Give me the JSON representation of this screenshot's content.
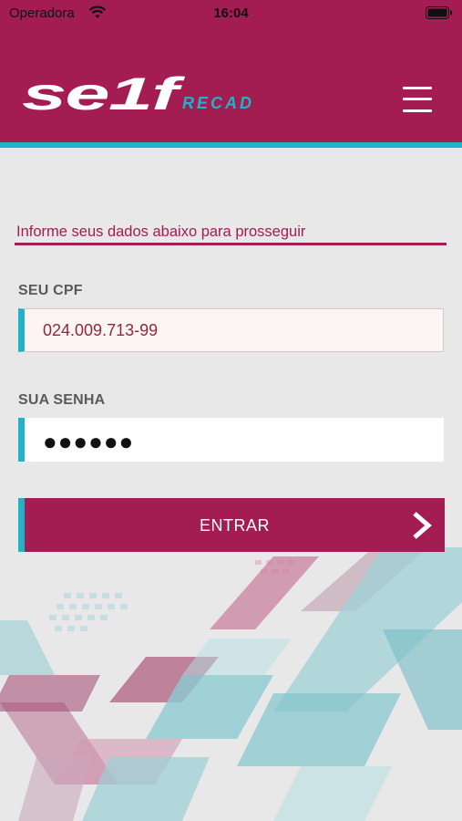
{
  "status_bar": {
    "carrier": "Operadora",
    "time": "16:04"
  },
  "header": {
    "logo_main": "SELF",
    "logo_sub": "RECAD",
    "menu_icon": "hamburger-menu-icon"
  },
  "form": {
    "prompt": "Informe seus dados abaixo para prosseguir",
    "cpf_label": "SEU CPF",
    "cpf_value": "024.009.713-99",
    "password_label": "SUA SENHA",
    "password_mask": "●●●●●●",
    "submit_label": "ENTRAR",
    "submit_icon": "chevron-right-icon"
  },
  "colors": {
    "brand": "#a31c52",
    "accent": "#1fb2c8",
    "background": "#e8e8e8"
  }
}
